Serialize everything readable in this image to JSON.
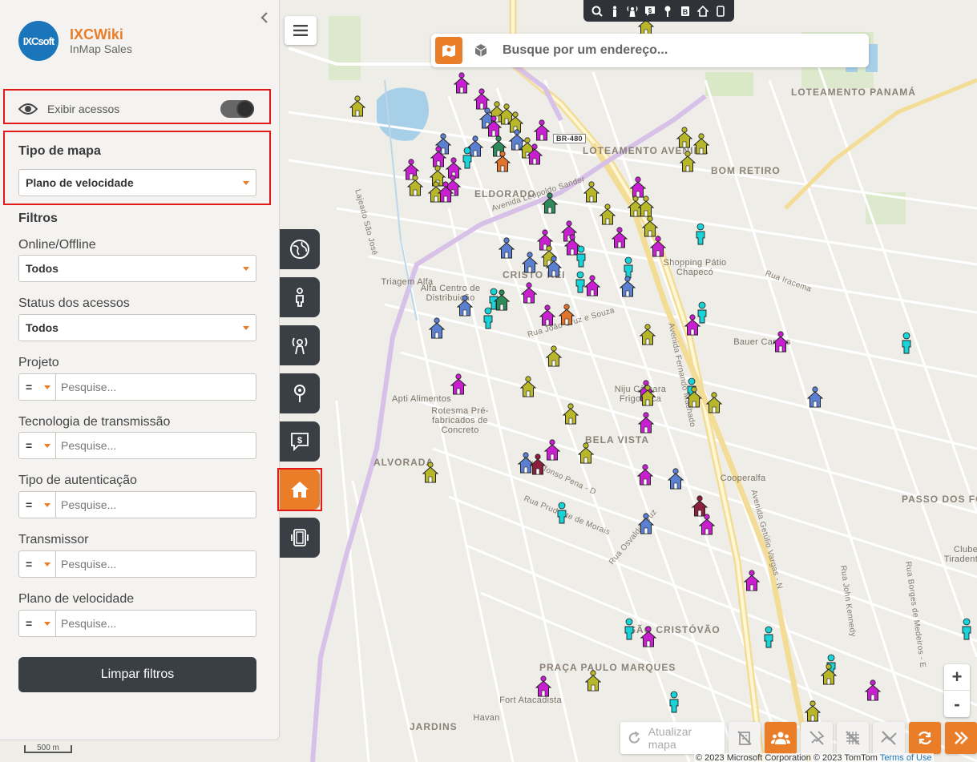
{
  "brand": {
    "logo_text": "IXCsoft",
    "title": "IXCWiki",
    "subtitle": "InMap Sales"
  },
  "layers": {
    "show_access_label": "Exibir acessos",
    "show_access_on": true
  },
  "map_type": {
    "title": "Tipo de mapa",
    "selected": "Plano de velocidade"
  },
  "filters": {
    "title": "Filtros",
    "online_offline": {
      "label": "Online/Offline",
      "value": "Todos"
    },
    "access_status": {
      "label": "Status dos acessos",
      "value": "Todos"
    },
    "project": {
      "label": "Projeto",
      "operator": "=",
      "placeholder": "Pesquise..."
    },
    "transmission_tech": {
      "label": "Tecnologia de transmissão",
      "operator": "=",
      "placeholder": "Pesquise..."
    },
    "auth_type": {
      "label": "Tipo de autenticação",
      "operator": "=",
      "placeholder": "Pesquise..."
    },
    "transmitter": {
      "label": "Transmissor",
      "operator": "=",
      "placeholder": "Pesquise..."
    },
    "speed_plan": {
      "label": "Plano de velocidade",
      "operator": "=",
      "placeholder": "Pesquise..."
    },
    "clear_label": "Limpar filtros"
  },
  "search": {
    "placeholder": "Busque por um endereço..."
  },
  "bottom": {
    "refresh_label": "Atualizar mapa"
  },
  "zoom": {
    "in": "+",
    "out": "-"
  },
  "attribution": {
    "text": "© 2023 Microsoft Corporation © 2023 TomTom ",
    "link": "Terms of Use"
  },
  "scale": "500 m",
  "colors": {
    "accent": "#e97d28",
    "dark": "#3a3f45",
    "highlight": "#e11919",
    "marker_cyan": "#18d3d8",
    "marker_magenta": "#c81fd0",
    "marker_olive": "#b8b72a",
    "marker_blue": "#5b7fd1",
    "marker_green": "#2e8a5b",
    "marker_orange": "#e2732a",
    "marker_maroon": "#8c1f3b"
  },
  "map_labels": [
    {
      "text": "LOTEAMENTO PANAMÁ",
      "kind": "area"
    },
    {
      "text": "LOTEAMENTO AVENIDA",
      "kind": "area"
    },
    {
      "text": "BOM RETIRO",
      "kind": "area"
    },
    {
      "text": "ELDORADO",
      "kind": "area"
    },
    {
      "text": "CRISTO REI",
      "kind": "area"
    },
    {
      "text": "BELA VISTA",
      "kind": "area"
    },
    {
      "text": "ALVORADA",
      "kind": "area"
    },
    {
      "text": "SÃO CRISTÓVÃO",
      "kind": "area"
    },
    {
      "text": "PRAÇA PAULO MARQUES",
      "kind": "area"
    },
    {
      "text": "JARDINS",
      "kind": "area"
    },
    {
      "text": "PASSO DOS FORTES",
      "kind": "area"
    },
    {
      "text": "Avenida Leopoldo Sander",
      "kind": "road"
    },
    {
      "text": "Avenida Fernando Machado",
      "kind": "road"
    },
    {
      "text": "Avenida Getúlio Vargas - N",
      "kind": "road"
    },
    {
      "text": "Rua Iracema",
      "kind": "road"
    },
    {
      "text": "Rua João Cruz e Souza",
      "kind": "road"
    },
    {
      "text": "Rua Afonso Pena - D",
      "kind": "road"
    },
    {
      "text": "Rua Prudente de Morais",
      "kind": "road"
    },
    {
      "text": "Rua Osvaldo Cruz",
      "kind": "road"
    },
    {
      "text": "Rua John Kennedy",
      "kind": "road"
    },
    {
      "text": "Rua Borges de Medeiros - E",
      "kind": "road"
    },
    {
      "text": "Shopping Pátio Chapecó",
      "kind": "poi"
    },
    {
      "text": "Bauer Cargas",
      "kind": "poi"
    },
    {
      "text": "Cooperalfa",
      "kind": "poi"
    },
    {
      "text": "Niju Câmara Frigorífica",
      "kind": "poi"
    },
    {
      "text": "Rotesma Pré-fabricados de Concreto",
      "kind": "poi"
    },
    {
      "text": "Apti Alimentos",
      "kind": "poi"
    },
    {
      "text": "Alfa Centro de Distribuição",
      "kind": "poi"
    },
    {
      "text": "Triagem Alfa",
      "kind": "poi"
    },
    {
      "text": "Fort Atacadista",
      "kind": "poi"
    },
    {
      "text": "Havan",
      "kind": "poi"
    },
    {
      "text": "Clube Tiradentes",
      "kind": "poi"
    },
    {
      "text": "BR-480",
      "kind": "shield"
    },
    {
      "text": "Lajeado São José",
      "kind": "road"
    }
  ]
}
